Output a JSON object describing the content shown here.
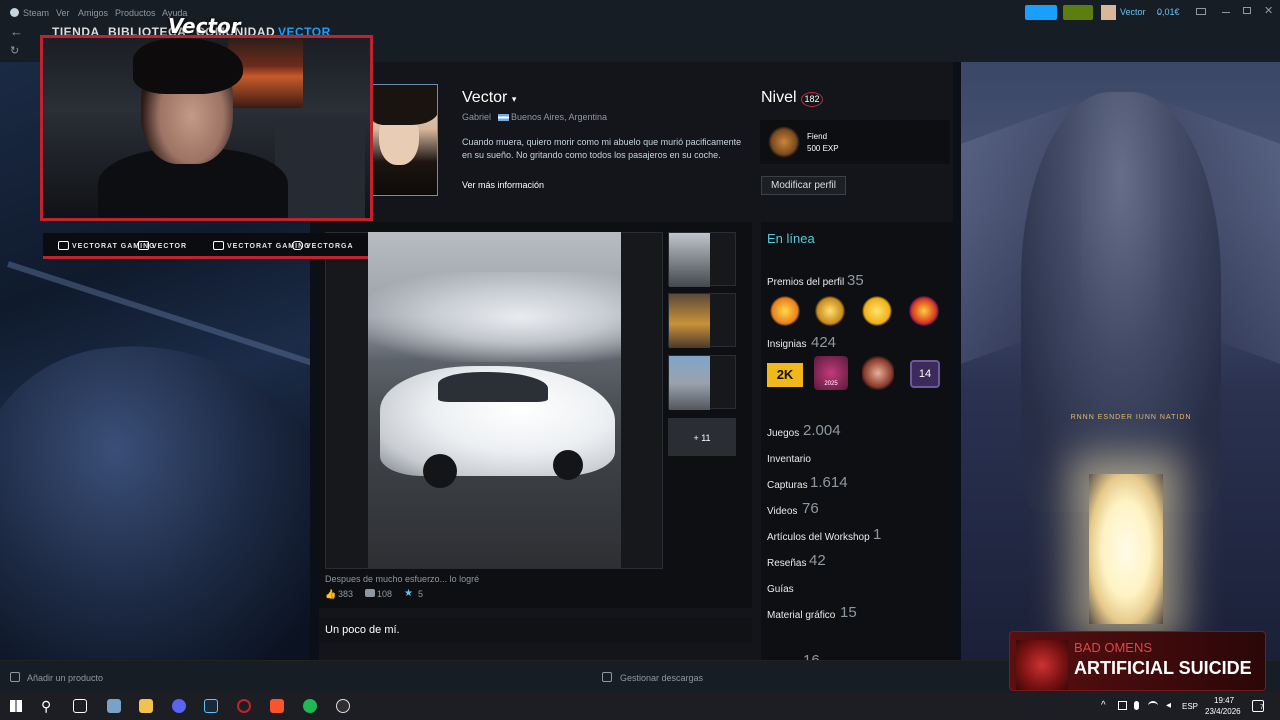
{
  "steam": {
    "menu": [
      "Steam",
      "Ver",
      "Amigos",
      "Productos",
      "Ayuda"
    ],
    "nav": {
      "store": "TIENDA",
      "library": "BIBLIOTECA",
      "community": "COMUNIDAD",
      "user": "VECTOR"
    },
    "account": {
      "name": "Vector",
      "balance": "0,01€"
    }
  },
  "overlay": {
    "brand": "Vector",
    "socials": [
      {
        "icon": "youtube-icon",
        "label": "VECTORAT GAMING"
      },
      {
        "icon": "twitch-icon",
        "label": "VECTOR"
      },
      {
        "icon": "twitter-icon",
        "label": "VECTORAT GAMING"
      },
      {
        "icon": "instagram-icon",
        "label": "VECTORGA"
      }
    ]
  },
  "profile": {
    "name": "Vector",
    "real_name": "Gabriel",
    "location": "Buenos Aires, Argentina",
    "summary": "Cuando muera, quiero morir como mi abuelo que murió pacificamente en su sueño. No gritando como todos los pasajeros en su coche.",
    "more_info": "Ver más información",
    "level_label": "Nivel",
    "level": "182",
    "badge_name": "Fiend",
    "badge_exp": "500 EXP",
    "edit_button": "Modificar perfil"
  },
  "showcase": {
    "caption": "Despues de mucho esfuerzo... lo logré",
    "likes": "383",
    "comments": "108",
    "awards": "5",
    "more": "+ 11",
    "about_title": "Un poco de mí."
  },
  "stats": {
    "status": "En línea",
    "profile_awards_label": "Premios del perfil",
    "profile_awards": "35",
    "badges_label": "Insignias",
    "badges": "424",
    "games_label": "Juegos",
    "games": "2.004",
    "inventory_label": "Inventario",
    "screenshots_label": "Capturas",
    "screenshots": "1.614",
    "videos_label": "Videos",
    "videos": "76",
    "workshop_label": "Artículos del Workshop",
    "workshop": "1",
    "reviews_label": "Reseñas",
    "reviews": "42",
    "guides_label": "Guías",
    "artwork_label": "Material gráfico",
    "artwork": "15",
    "next_partial": "16",
    "badge_14": "14",
    "badge_2k": "2K",
    "badge_year": "2025"
  },
  "bottom": {
    "add_product": "Añadir un producto",
    "manage_downloads": "Gestionar descargas"
  },
  "music": {
    "artist": "BAD OMENS",
    "track": "ARTIFICIAL SUICIDE"
  },
  "runes": "RNNN ESNDER IUNN NATIDN",
  "taskbar": {
    "lang": "ESP",
    "time": "19:47",
    "date": "23/4/2026",
    "notifications": "7"
  },
  "colors": {
    "accent": "#66c0f4",
    "overlay_red": "#c0232e",
    "steam_bar": "#171d25"
  }
}
